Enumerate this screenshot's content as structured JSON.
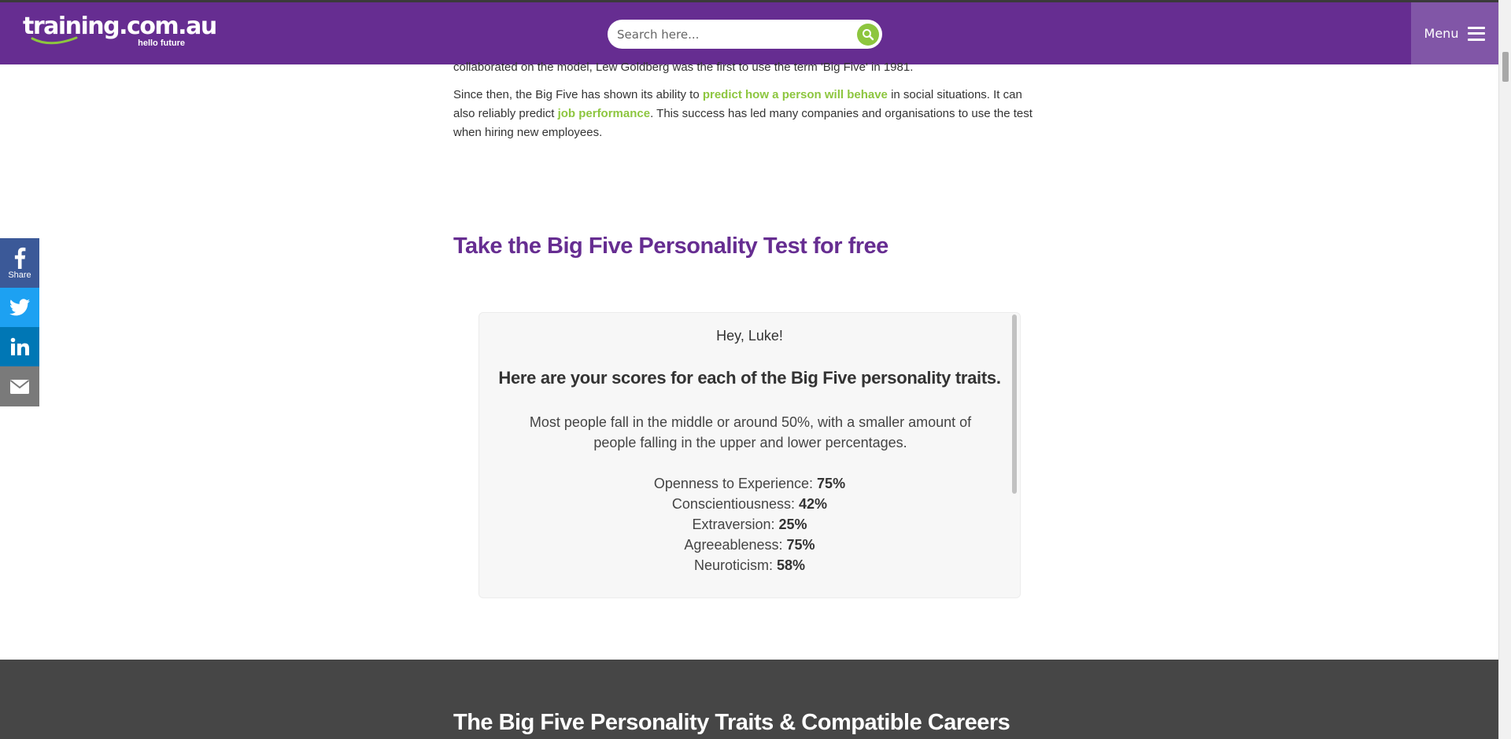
{
  "header": {
    "logo_text": "training.com.au",
    "logo_tagline": "hello future",
    "search_placeholder": "Search here...",
    "menu_label": "Menu"
  },
  "article": {
    "partial_line": "collaborated on the model, Lew Goldberg was the first to use the term 'Big Five' in 1981.",
    "para_part1": "Since then, the Big Five has shown its ability to ",
    "para_link1": "predict how a person will behave",
    "para_part2": " in social situations. It can also reliably predict ",
    "para_link2": "job performance",
    "para_part3": ". This success has led many companies and organisations to use the test when hiring new employees."
  },
  "section_title": "Take the Big Five Personality Test for free",
  "results": {
    "greeting": "Hey, Luke!",
    "heading": "Here are your scores for each of the Big Five personality traits.",
    "description": "Most people fall in the middle or around 50%, with a smaller amount of people falling in the upper and lower percentages.",
    "scores": [
      {
        "trait": "Openness to Experience:",
        "value": "75%"
      },
      {
        "trait": "Conscientiousness:",
        "value": "42%"
      },
      {
        "trait": "Extraversion:",
        "value": "25%"
      },
      {
        "trait": "Agreeableness:",
        "value": "75%"
      },
      {
        "trait": "Neuroticism:",
        "value": "58%"
      }
    ]
  },
  "share": {
    "facebook_label": "Share",
    "icons": [
      "facebook-icon",
      "twitter-icon",
      "linkedin-icon",
      "email-icon"
    ]
  },
  "next_section_title": "The Big Five Personality Traits & Compatible Careers",
  "colors": {
    "brand_purple": "#662d91",
    "menu_purple": "#8156a7",
    "accent_green": "#8dc63f",
    "facebook": "#3b5998",
    "twitter": "#1da1f2",
    "linkedin": "#0077b5",
    "email": "#7a7a7a",
    "dark_section": "#464646"
  }
}
